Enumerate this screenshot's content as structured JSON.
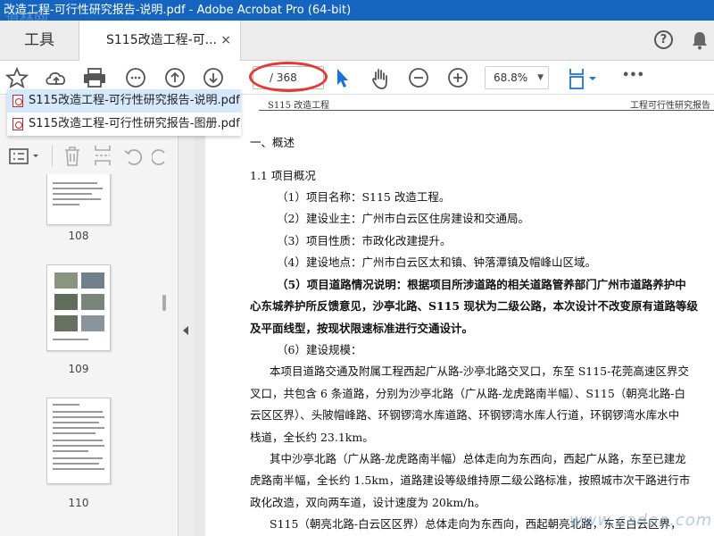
{
  "window": {
    "title": "改造工程-可行性研究报告-说明.pdf - Adobe Acrobat Pro (64-bit)",
    "watermark": "道林网"
  },
  "tabs": {
    "tools_label": "工具",
    "doc_tab_label": "S115改造工程-可...",
    "close_glyph": "×",
    "help_glyph": "?"
  },
  "toolbar": {
    "page_display": "/ 368",
    "zoom_value": "68.8%",
    "more_glyph": "•••"
  },
  "open_documents": [
    {
      "name": "S115改造工程-可行性研究报告-说明.pdf",
      "active": true
    },
    {
      "name": "S115改造工程-可行性研究报告-图册.pdf",
      "active": false
    }
  ],
  "thumbnails": [
    {
      "page": "108"
    },
    {
      "page": "109"
    },
    {
      "page": "110"
    }
  ],
  "document": {
    "header_left": "S115 改造工程",
    "header_right": "工程可行性研究报告",
    "lines": [
      "一、概述",
      "1.1  项目概况",
      "（1）项目名称：S115 改造工程。",
      "（2）建设业主：广州市白云区住房建设和交通局。",
      "（3）项目性质：市政化改建提升。",
      "（4）建设地点：广州市白云区太和镇、钟落潭镇及帽峰山区域。",
      "（5）项目道路情况说明：根据项目所涉道路的相关道路管养部门广州市道路养护中",
      "心东城养护所反馈意见，沙亭北路、S115 现状为二级公路，本次设计不改变原有道路等级",
      "及平面线型，按现状限速标准进行交通设计。",
      "（6）建设规模：",
      "本项目道路交通及附属工程西起广从路-沙亭北路交叉口，东至 S115-花莞高速区界交",
      "叉口，共包含 6 条道路，分别为沙亭北路（广从路-龙虎路南半幅）、S115（朝亮北路-白",
      "云区区界）、头陂帽峰路、环钢锣湾水库道路、环钢锣湾水库人行道，环钢锣湾水库水中",
      "栈道，全长约 23.1km。",
      "其中沙亭北路（广从路-龙虎路南半幅）总体走向为东西向，西起广从路，东至已建龙",
      "虎路南半幅，全长约 1.5km，道路建设等级维持原二级公路标准，按照城市次干路进行市",
      "政化改造，双向两车道，设计速度为 20km/h。",
      "S115（朝亮北路-白云区区界）总体走向为东西向，西起朝亮北路，东至白云区界，"
    ]
  },
  "site_watermark": "www.cadoo.com"
}
